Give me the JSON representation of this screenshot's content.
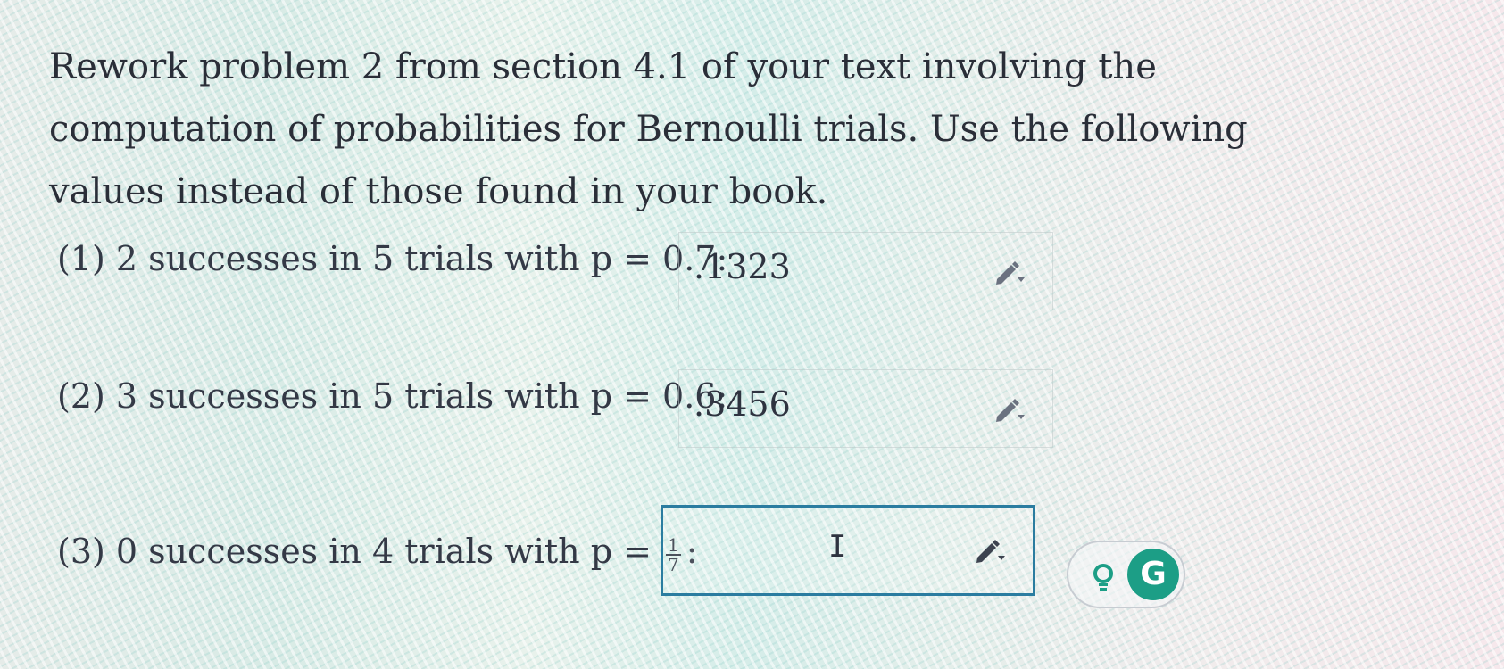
{
  "prompt": "Rework problem 2 from section 4.1 of your text involving the computation of probabilities for Bernoulli trials. Use the following values instead of those found in your book.",
  "questions": [
    {
      "label": "(1) 2 successes in 5 trials with p = 0.7:",
      "answer": ".1323"
    },
    {
      "label": "(2) 3 successes in 5 trials with p = 0.6:",
      "answer": ".3456"
    },
    {
      "label_prefix": "(3) 0 successes in 4 trials with p =",
      "fraction_numerator": "1",
      "fraction_denominator": "7",
      "label_suffix": ":",
      "answer": ""
    }
  ],
  "colors": {
    "active_box_border": "#2a7ca0",
    "grammarly_green": "#1c9e86"
  },
  "icons": {
    "edit": "pencil-dropdown-icon",
    "cursor": "text-cursor-icon",
    "grammarly_suggestion": "lightbulb-icon",
    "grammarly": "grammarly-logo-icon"
  },
  "grammarly": {
    "logo_letter": "G"
  },
  "cursor_glyph": "I"
}
